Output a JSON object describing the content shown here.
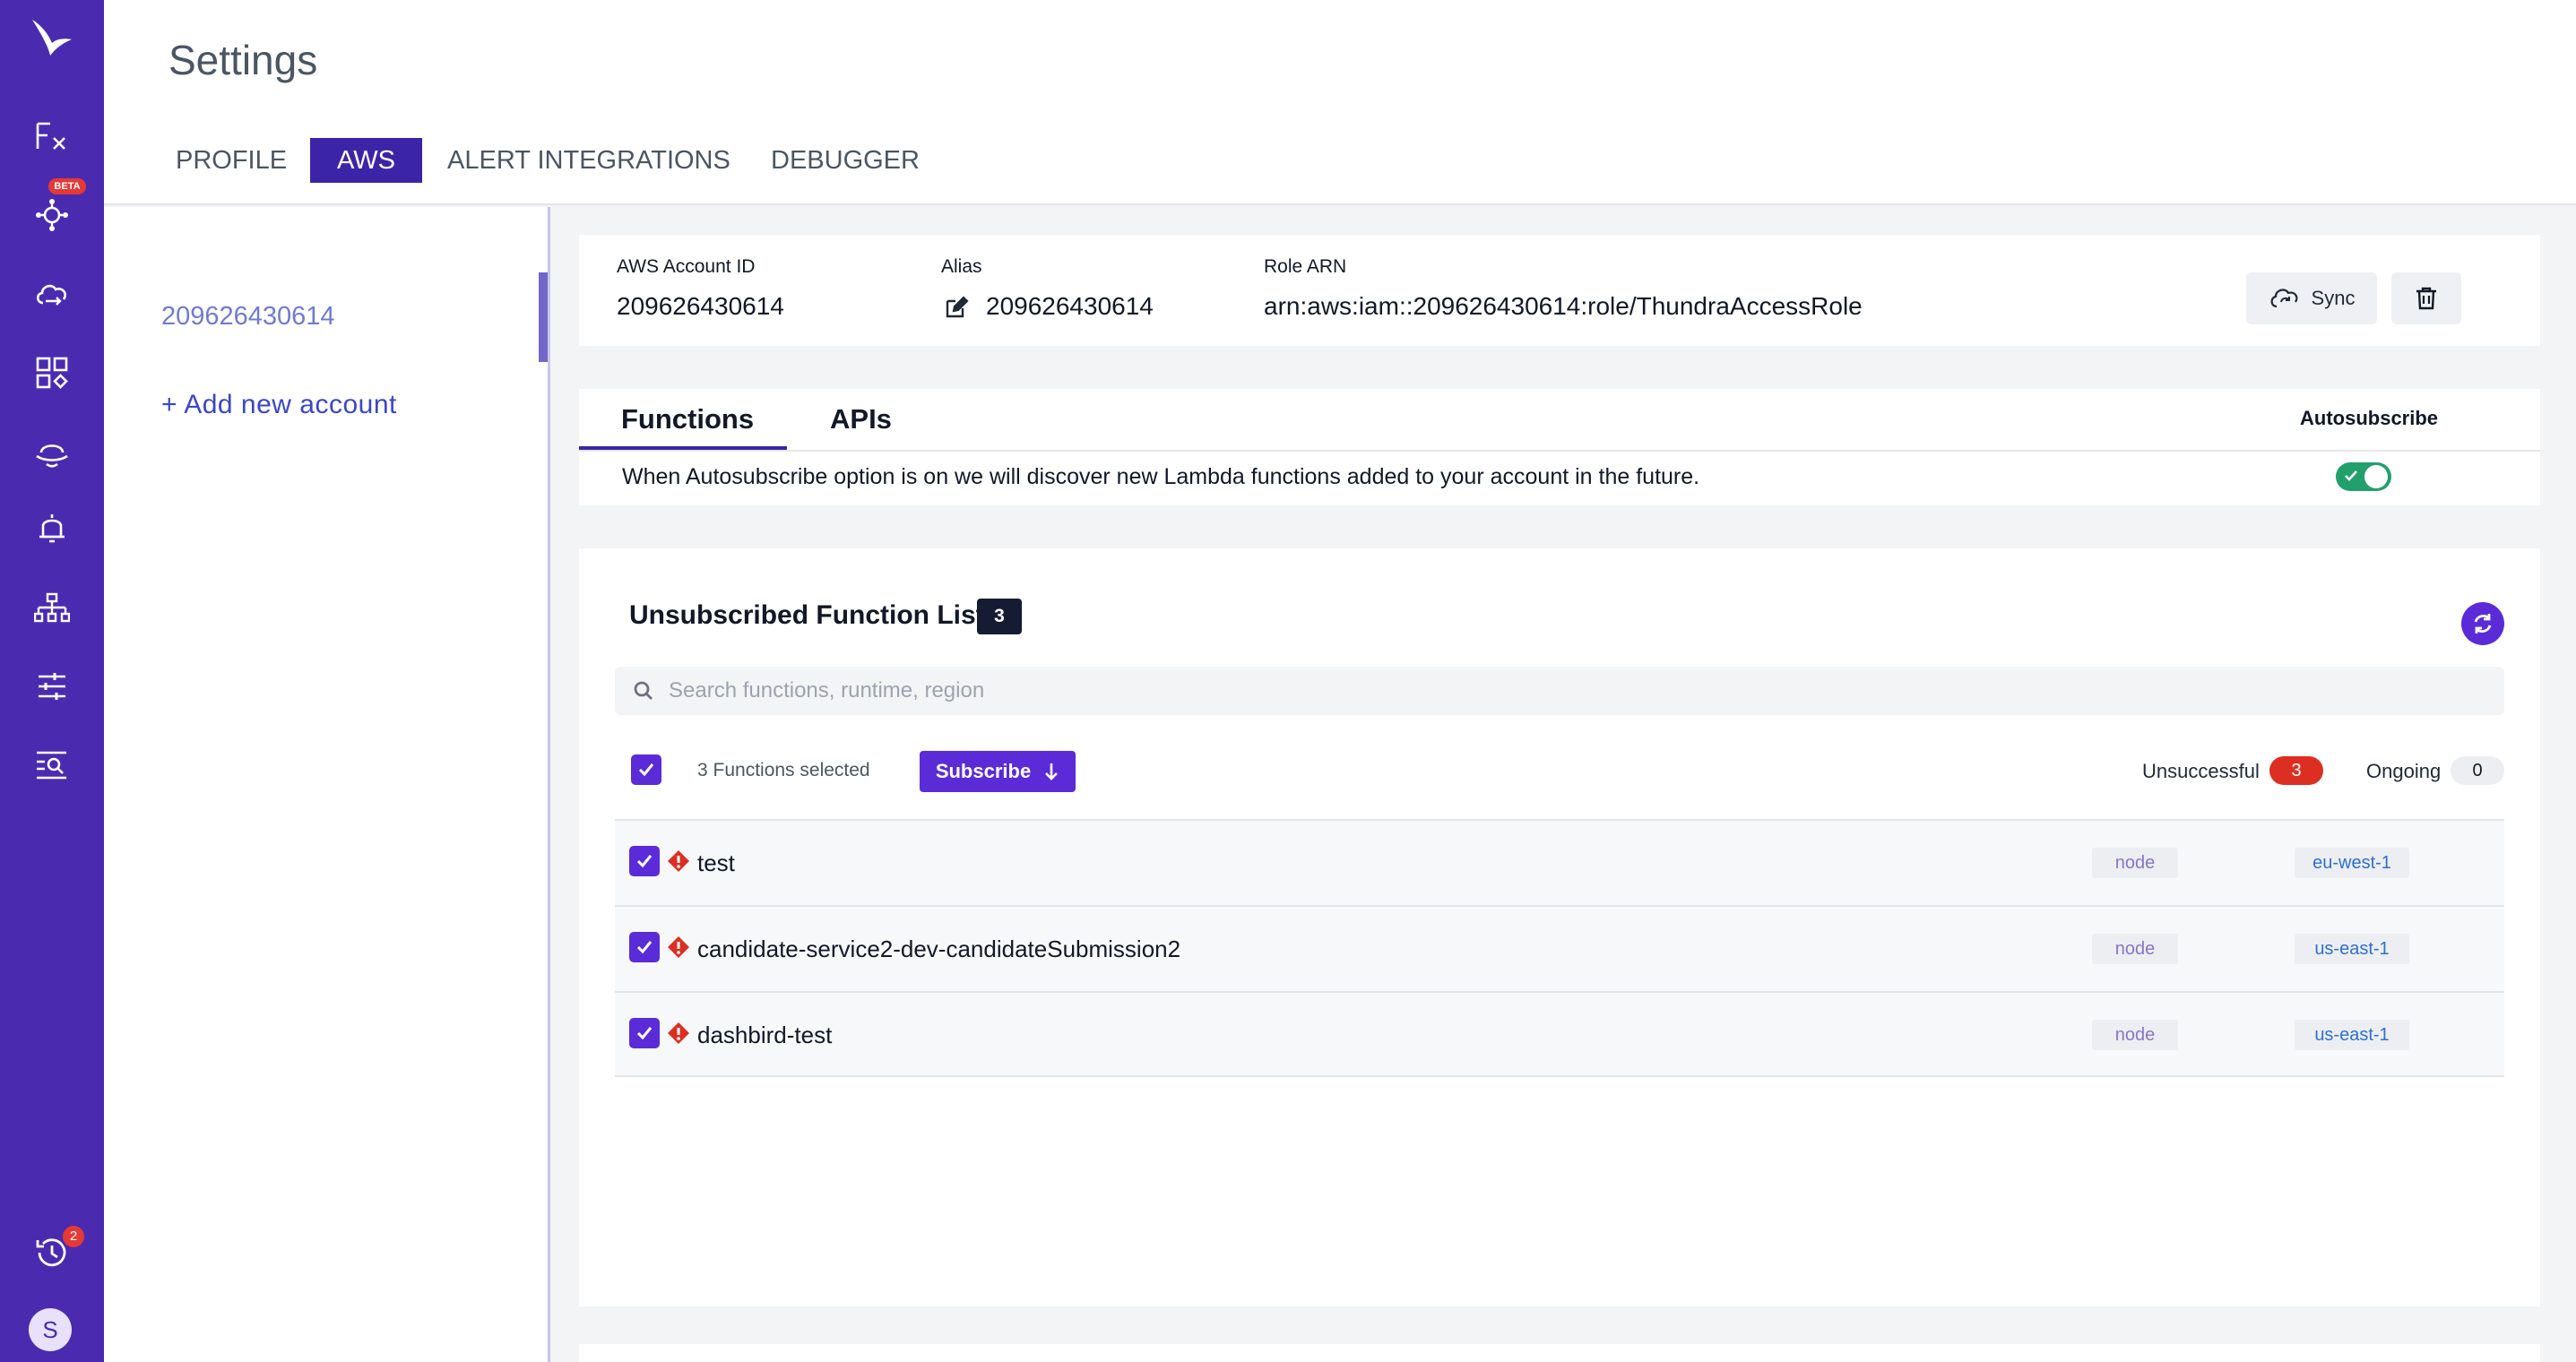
{
  "rail": {
    "beta_badge": "BETA",
    "history_count": "2",
    "avatar_initial": "S",
    "items": [
      {
        "name": "functions",
        "glyph": "F"
      },
      {
        "name": "architecture"
      },
      {
        "name": "aws-services"
      },
      {
        "name": "dashboards"
      },
      {
        "name": "operations"
      },
      {
        "name": "alerts"
      },
      {
        "name": "topology"
      },
      {
        "name": "filters"
      },
      {
        "name": "search-logs"
      }
    ]
  },
  "header": {
    "title": "Settings",
    "tabs": [
      "PROFILE",
      "AWS",
      "ALERT INTEGRATIONS",
      "DEBUGGER"
    ],
    "active_tab": "AWS"
  },
  "accounts": {
    "selected_id": "209626430614",
    "add_label": "+ Add new account"
  },
  "account_card": {
    "account_id_label": "AWS Account ID",
    "account_id": "209626430614",
    "alias_label": "Alias",
    "alias": "209626430614",
    "role_label": "Role ARN",
    "role_arn": "arn:aws:iam::209626430614:role/ThundraAccessRole",
    "sync_label": "Sync"
  },
  "functions_panel": {
    "tabs": [
      "Functions",
      "APIs"
    ],
    "active_tab": "Functions",
    "autosubscribe_label": "Autosubscribe",
    "autosubscribe_on": true,
    "autosubscribe_desc": "When Autosubscribe option is on we will discover new Lambda functions added to your account in the future."
  },
  "unsubscribed": {
    "title": "Unsubscribed Function List",
    "count": "3",
    "search_placeholder": "Search functions, runtime, region",
    "selected_text": "3 Functions selected",
    "subscribe_label": "Subscribe",
    "unsuccessful_label": "Unsuccessful",
    "unsuccessful_count": "3",
    "ongoing_label": "Ongoing",
    "ongoing_count": "0",
    "rows": [
      {
        "name": "test",
        "runtime": "node",
        "region": "eu-west-1"
      },
      {
        "name": "candidate-service2-dev-candidateSubmission2",
        "runtime": "node",
        "region": "us-east-1"
      },
      {
        "name": "dashbird-test",
        "runtime": "node",
        "region": "us-east-1"
      }
    ]
  },
  "colors": {
    "rail": "#4a2bb0",
    "accent": "#5b2bd8",
    "toggle_on": "#22a06b",
    "error": "#dc2f22"
  }
}
